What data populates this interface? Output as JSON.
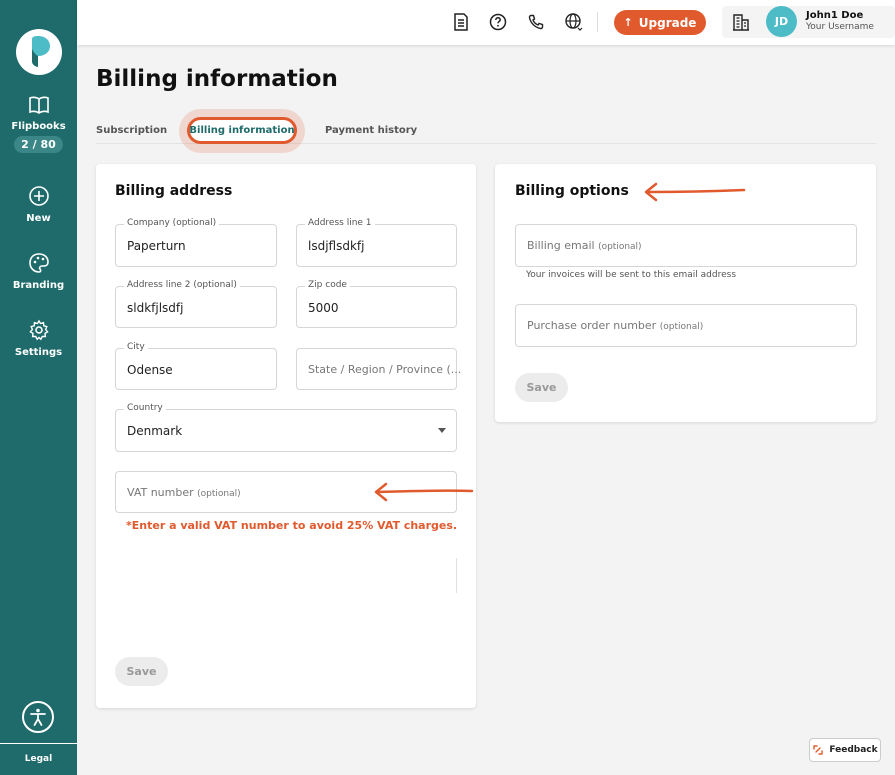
{
  "sidebar": {
    "nav": [
      {
        "label": "Flipbooks",
        "badge": "2 / 80",
        "icon": "book-icon"
      },
      {
        "label": "New",
        "icon": "plus-circle-icon"
      },
      {
        "label": "Branding",
        "icon": "palette-icon"
      },
      {
        "label": "Settings",
        "icon": "gear-icon"
      }
    ],
    "legal": "Legal"
  },
  "header": {
    "upgrade": "Upgrade",
    "user": {
      "initials": "JD",
      "name": "John1 Doe",
      "username": "Your Username"
    }
  },
  "page": {
    "title": "Billing information",
    "tabs": [
      "Subscription",
      "Billing information",
      "Payment history"
    ]
  },
  "billing_address": {
    "title": "Billing address",
    "company": {
      "label": "Company (optional)",
      "value": "Paperturn"
    },
    "address1": {
      "label": "Address line 1",
      "value": "lsdjflsdkfj"
    },
    "address2": {
      "label": "Address line 2 (optional)",
      "value": "sldkfjlsdfj"
    },
    "zip": {
      "label": "Zip code",
      "value": "5000"
    },
    "city": {
      "label": "City",
      "value": "Odense"
    },
    "state": {
      "placeholder": "State / Region / Province (..."
    },
    "country": {
      "label": "Country",
      "value": "Denmark"
    },
    "vat": {
      "placeholder": "VAT number",
      "optional": "(optional)"
    },
    "vat_warning": "*Enter a valid VAT number to avoid 25% VAT charges.",
    "save": "Save"
  },
  "billing_options": {
    "title": "Billing options",
    "email": {
      "placeholder": "Billing email",
      "optional": "(optional)"
    },
    "email_helper": "Your invoices will be sent to this email address",
    "po": {
      "placeholder": "Purchase order number",
      "optional": "(optional)"
    },
    "save": "Save"
  },
  "feedback": "Feedback",
  "colors": {
    "sidebar": "#1f6b6b",
    "accent": "#e05a2e",
    "avatar": "#4dbcc7"
  }
}
